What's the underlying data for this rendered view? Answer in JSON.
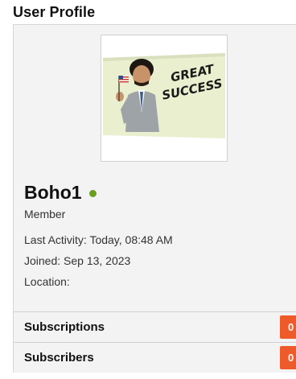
{
  "header": {
    "title": "User Profile"
  },
  "profile": {
    "avatar_text": "GREAT SUCCESS",
    "username": "Boho1",
    "status": "online",
    "role": "Member",
    "last_activity": "Last Activity: Today, 08:48 AM",
    "joined": "Joined: Sep 13, 2023",
    "location": "Location:"
  },
  "stats": {
    "subscriptions_label": "Subscriptions",
    "subscriptions_count": "0",
    "subscribers_label": "Subscribers",
    "subscribers_count": "0"
  },
  "colors": {
    "online": "#6a9e1f",
    "badge": "#ef5a2b",
    "panel_bg": "#f3f3f3"
  }
}
